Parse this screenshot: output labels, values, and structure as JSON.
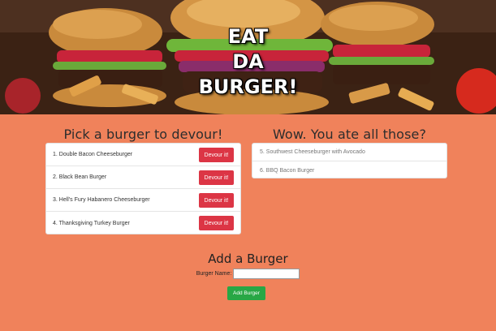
{
  "hero": {
    "title_lines": [
      "EAT",
      "DA",
      "BURGER!"
    ]
  },
  "devour_section": {
    "title": "Pick a burger to devour!",
    "button_label": "Devour it!",
    "burgers": [
      "1. Double Bacon Cheeseburger",
      "2. Black Bean Burger",
      "3. Hell's Fury Habanero Cheeseburger",
      "4. Thanksgiving Turkey Burger"
    ]
  },
  "eaten_section": {
    "title": "Wow. You ate all those?",
    "burgers": [
      "5. Southwest Cheeseburger with Avocado",
      "6. BBQ Bacon Burger"
    ]
  },
  "add_section": {
    "title": "Add a Burger",
    "field_label": "Burger Name:",
    "field_value": "",
    "button_label": "Add Burger"
  },
  "colors": {
    "background": "#f0825b",
    "devour_button": "#dc3545",
    "add_button": "#28a745"
  }
}
